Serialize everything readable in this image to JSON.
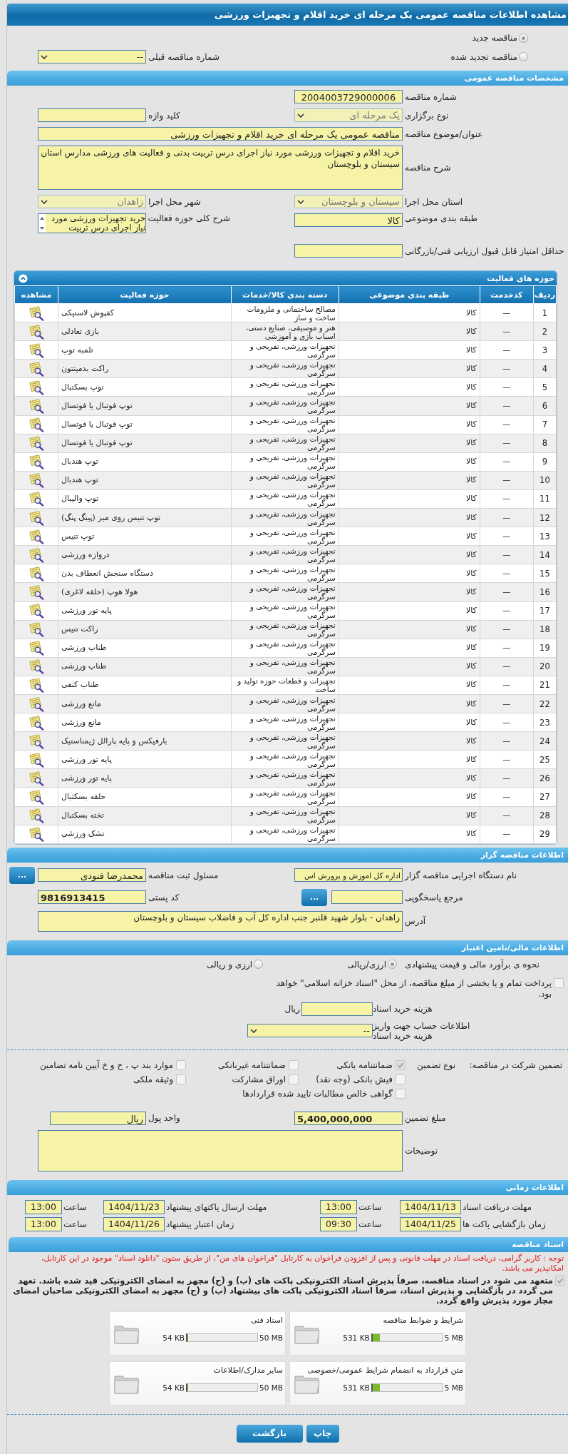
{
  "page_title": "مشاهده اطلاعات مناقصه عمومی یک مرحله ای خرید اقلام و تجهیزات ورزشی",
  "renewal": {
    "options": [
      {
        "label": "مناقصه جدید",
        "selected": true
      },
      {
        "label": "مناقصه تجدید شده",
        "selected": false
      }
    ],
    "previous_tender": {
      "label": "شماره مناقصه قبلی",
      "value": "--",
      "disabled": false
    }
  },
  "general": {
    "title": "مشخصات مناقصه عمومی",
    "tender_number": {
      "label": "شماره مناقصه",
      "value": "2004003729000006"
    },
    "holding_type": {
      "label": "نوع برگزاری",
      "value": "یک مرحله ای",
      "disabled": true
    },
    "keyword": {
      "label": "کلید واژه"
    },
    "subject": {
      "label": "عنوان/موضوع مناقصه",
      "value": "مناقصه عمومی یک مرحله ای  خرید اقلام و تجهیزات ورزشی"
    },
    "description": {
      "label": "شرح مناقصه",
      "value": "خرید اقلام و  تجهیزات ورزشی مورد نیاز اجرای درس تربیت بدنی و فعالیت های ورزشی مدارس استان سیستان و بلوچستان"
    },
    "province": {
      "label": "استان محل اجرا",
      "value": "سیستان و بلوچستان",
      "disabled": true
    },
    "city": {
      "label": "شهر محل اجرا",
      "value": "زاهدان",
      "disabled": true
    },
    "subject_class": {
      "label": "طبقه بندی موضوعی",
      "value": "کالا"
    },
    "activity_summary": {
      "label": "شرح کلی حوزه فعالیت",
      "value": "خرید تجهیزات ورزشی مورد نیاز اجرای درس تربیت"
    },
    "min_score": {
      "label": "حداقل امتیاز قابل قبول ارزیابی فنی/بازرگانی"
    }
  },
  "activities": {
    "title": "حوزه های فعالیت",
    "columns": [
      "ردیف",
      "کدخدمت",
      "طبقه بندی موضوعی",
      "دسته بندی کالا/خدمات",
      "حوزه فعالیت",
      "مشاهده"
    ],
    "rows": [
      {
        "index": "1",
        "service_code": "—",
        "subject_class": "کالا",
        "goods_group": "مصالح ساختمانی و ملزومات ساخت و ساز",
        "activity": "کفپوش لاستیکی"
      },
      {
        "index": "2",
        "service_code": "—",
        "subject_class": "کالا",
        "goods_group": "هنر و موسیقی، صنایع دستی، اسباب بازی و آموزشی",
        "activity": "بازی تعادلی"
      },
      {
        "index": "3",
        "service_code": "—",
        "subject_class": "کالا",
        "goods_group": "تجهیزات ورزشی، تفریحی و سرگرمی",
        "activity": "تلمبه توپ"
      },
      {
        "index": "4",
        "service_code": "—",
        "subject_class": "کالا",
        "goods_group": "تجهیزات ورزشی، تفریحی و سرگرمی",
        "activity": "راکت بدمینتون"
      },
      {
        "index": "5",
        "service_code": "—",
        "subject_class": "کالا",
        "goods_group": "تجهیزات ورزشی، تفریحی و سرگرمی",
        "activity": "توپ بسکتبال"
      },
      {
        "index": "6",
        "service_code": "—",
        "subject_class": "کالا",
        "goods_group": "تجهیزات ورزشی، تفریحی و سرگرمی",
        "activity": "توپ فوتبال یا فوتسال"
      },
      {
        "index": "7",
        "service_code": "—",
        "subject_class": "کالا",
        "goods_group": "تجهیزات ورزشی، تفریحی و سرگرمی",
        "activity": "توپ فوتبال یا فوتسال"
      },
      {
        "index": "8",
        "service_code": "—",
        "subject_class": "کالا",
        "goods_group": "تجهیزات ورزشی، تفریحی و سرگرمی",
        "activity": "توپ فوتبال یا فوتسال"
      },
      {
        "index": "9",
        "service_code": "—",
        "subject_class": "کالا",
        "goods_group": "تجهیزات ورزشی، تفریحی و سرگرمی",
        "activity": "توپ هندبال"
      },
      {
        "index": "10",
        "service_code": "—",
        "subject_class": "کالا",
        "goods_group": "تجهیزات ورزشی، تفریحی و سرگرمی",
        "activity": "توپ هندبال"
      },
      {
        "index": "11",
        "service_code": "—",
        "subject_class": "کالا",
        "goods_group": "تجهیزات ورزشی، تفریحی و سرگرمی",
        "activity": "توپ والیبال"
      },
      {
        "index": "12",
        "service_code": "—",
        "subject_class": "کالا",
        "goods_group": "تجهیزات ورزشی، تفریحی و سرگرمی",
        "activity": "توپ تنیس روی میز (پینگ پنگ)"
      },
      {
        "index": "13",
        "service_code": "—",
        "subject_class": "کالا",
        "goods_group": "تجهیزات ورزشی، تفریحی و سرگرمی",
        "activity": "توپ تنیس"
      },
      {
        "index": "14",
        "service_code": "—",
        "subject_class": "کالا",
        "goods_group": "تجهیزات ورزشی، تفریحی و سرگرمی",
        "activity": "دروازه ورزشی"
      },
      {
        "index": "15",
        "service_code": "—",
        "subject_class": "کالا",
        "goods_group": "تجهیزات ورزشی، تفریحی و سرگرمی",
        "activity": "دستگاه سنجش انعطاف بدن"
      },
      {
        "index": "16",
        "service_code": "—",
        "subject_class": "کالا",
        "goods_group": "تجهیزات ورزشی، تفریحی و سرگرمی",
        "activity": "هولا هوپ (حلقه لاغری)"
      },
      {
        "index": "17",
        "service_code": "—",
        "subject_class": "کالا",
        "goods_group": "تجهیزات ورزشی، تفریحی و سرگرمی",
        "activity": "پایه تور ورزشی"
      },
      {
        "index": "18",
        "service_code": "—",
        "subject_class": "کالا",
        "goods_group": "تجهیزات ورزشی، تفریحی و سرگرمی",
        "activity": "راکت تنیس"
      },
      {
        "index": "19",
        "service_code": "—",
        "subject_class": "کالا",
        "goods_group": "تجهیزات ورزشی، تفریحی و سرگرمی",
        "activity": "طناب ورزشی"
      },
      {
        "index": "20",
        "service_code": "—",
        "subject_class": "کالا",
        "goods_group": "تجهیزات ورزشی، تفریحی و سرگرمی",
        "activity": "طناب ورزشی"
      },
      {
        "index": "21",
        "service_code": "—",
        "subject_class": "کالا",
        "goods_group": "تجهیزات و قطعات حوزه تولید و ساخت",
        "activity": "طناب کنفی"
      },
      {
        "index": "22",
        "service_code": "—",
        "subject_class": "کالا",
        "goods_group": "تجهیزات ورزشی، تفریحی و سرگرمی",
        "activity": "مانع ورزشی"
      },
      {
        "index": "23",
        "service_code": "—",
        "subject_class": "کالا",
        "goods_group": "تجهیزات ورزشی، تفریحی و سرگرمی",
        "activity": "مانع ورزشی"
      },
      {
        "index": "24",
        "service_code": "—",
        "subject_class": "کالا",
        "goods_group": "تجهیزات ورزشی، تفریحی و سرگرمی",
        "activity": "بارفیکس و پایه پارالل ژیمناستیک"
      },
      {
        "index": "25",
        "service_code": "—",
        "subject_class": "کالا",
        "goods_group": "تجهیزات ورزشی، تفریحی و سرگرمی",
        "activity": "پایه تور ورزشی"
      },
      {
        "index": "26",
        "service_code": "—",
        "subject_class": "کالا",
        "goods_group": "تجهیزات ورزشی، تفریحی و سرگرمی",
        "activity": "پایه تور ورزشی"
      },
      {
        "index": "27",
        "service_code": "—",
        "subject_class": "کالا",
        "goods_group": "تجهیزات ورزشی، تفریحی و سرگرمی",
        "activity": "حلقه بسکتبال"
      },
      {
        "index": "28",
        "service_code": "—",
        "subject_class": "کالا",
        "goods_group": "تجهیزات ورزشی، تفریحی و سرگرمی",
        "activity": "تخته بسکتبال"
      },
      {
        "index": "29",
        "service_code": "—",
        "subject_class": "کالا",
        "goods_group": "تجهیزات ورزشی، تفریحی و سرگرمی",
        "activity": "تشک ورزشی"
      }
    ]
  },
  "publisher": {
    "title": "اطلاعات مناقصه گزار",
    "agency": {
      "label": "نام دستگاه اجرایی مناقصه گزار",
      "value": "اداره کل اموزش و پرورش اس"
    },
    "registrar": {
      "label": "مسئول ثبت مناقصه",
      "value": "محمدرضا فنودی",
      "button": "..."
    },
    "responder": {
      "label": "مرجع پاسخگویی",
      "button": "..."
    },
    "postal_code": {
      "label": "کد پستی",
      "value": "9816913415"
    },
    "address": {
      "label": "آدرس",
      "value": "زاهدان - بلوار شهید قلنبر جنب اداره کل آب و فاضلاب سیستان و بلوچستان"
    }
  },
  "finance": {
    "title": "اطلاعات مالی/تامین اعتبار",
    "estimate": {
      "label": "نحوه ی برآورد مالی و قیمت پیشنهادی",
      "options": [
        {
          "label": "ارزی/ریالی",
          "selected": true
        },
        {
          "label": "ارزی و ریالی",
          "selected": false
        }
      ]
    },
    "treasury": {
      "label": "پرداخت تمام و یا بخشی از مبلغ مناقصه، از محل \"اسناد خزانه اسلامی\" خواهد بود.",
      "checked": false
    },
    "doc_fee": {
      "label": "هزینه خرید اسناد",
      "unit": "ریال"
    },
    "account": {
      "label": "اطلاعات حساب جهت واریز هزینه خرید اسناد",
      "value": "--"
    }
  },
  "guarantee": {
    "label": "تضمین شرکت در مناقصه:",
    "type_label": "نوع تضمین",
    "options": [
      {
        "label": "ضمانتنامه بانکی",
        "checked": true
      },
      {
        "label": "ضمانتنامه غیربانکی",
        "checked": false
      },
      {
        "label": "موارد بند پ ، ح و خ آیین نامه تضامین",
        "checked": false
      },
      {
        "label": "فیش بانکی (وجه نقد)",
        "checked": false
      },
      {
        "label": "اوراق مشارکت",
        "checked": false
      },
      {
        "label": "وثیقه ملکی",
        "checked": false
      },
      {
        "label": "گواهی خالص مطالبات تایید شده قراردادها",
        "checked": false
      }
    ],
    "amount": {
      "label": "مبلغ تضمین",
      "value": "5,400,000,000"
    },
    "currency": {
      "label": "واحد پول",
      "value": "ریال"
    },
    "notes": {
      "label": "توضیحات"
    }
  },
  "timing": {
    "title": "اطلاعات زمانی",
    "items": [
      {
        "label": "مهلت دریافت اسناد",
        "date": "1404/11/13",
        "time_label": "ساعت",
        "time": "13:00"
      },
      {
        "label": "مهلت ارسال پاکتهای پیشنهاد",
        "date": "1404/11/23",
        "time_label": "ساعت",
        "time": "13:00"
      },
      {
        "label": "زمان بازگشایی پاکت ها",
        "date": "1404/11/25",
        "time_label": "ساعت",
        "time": "09:30"
      },
      {
        "label": "زمان اعتبار پیشنهاد",
        "date": "1404/11/26",
        "time_label": "ساعت",
        "time": "13:00"
      }
    ]
  },
  "documents": {
    "title": "اسناد مناقصه",
    "notice": "توجه : کاربر گرامی، دریافت اسناد در مهلت قانونی و پس از افزودن فراخوان به کارتابل \"فراخوان های من\"، از طریق ستون \"دانلود اسناد\" موجود در این کارتابل، امکانپذیر می باشد.",
    "commitment": {
      "text": "متعهد می شود در اسناد مناقصه، صرفاً پذیرش اسناد الکترونیکی پاکت های (ب) و (ج) مجهز به امضای الکترونیکی قید شده باشد. تعهد می گردد در بازگشایی و پذیرش اسناد، صرفاً اسناد الکترونیکی پاکت های پیشنهاد (ب) و (ج) مجهز به امضای الکترونیکی صاحبان امضای مجاز مورد پذیرش واقع گردد.",
      "checked": true
    },
    "files": [
      {
        "name": "شرایط و ضوابط مناقصه",
        "used": "531 KB",
        "max": "5 MB",
        "level": 0.1
      },
      {
        "name": "اسناد فنی",
        "used": "54 KB",
        "max": "50 MB",
        "level": 0.01
      },
      {
        "name": "متن قرارداد به انضمام شرایط عمومی/خصوصی",
        "used": "531 KB",
        "max": "5 MB",
        "level": 0.1
      },
      {
        "name": "سایر مدارک/اطلاعات",
        "used": "54 KB",
        "max": "50 MB",
        "level": 0.01
      }
    ]
  },
  "buttons": [
    {
      "label": "چاپ"
    },
    {
      "label": "بازگشت"
    }
  ]
}
